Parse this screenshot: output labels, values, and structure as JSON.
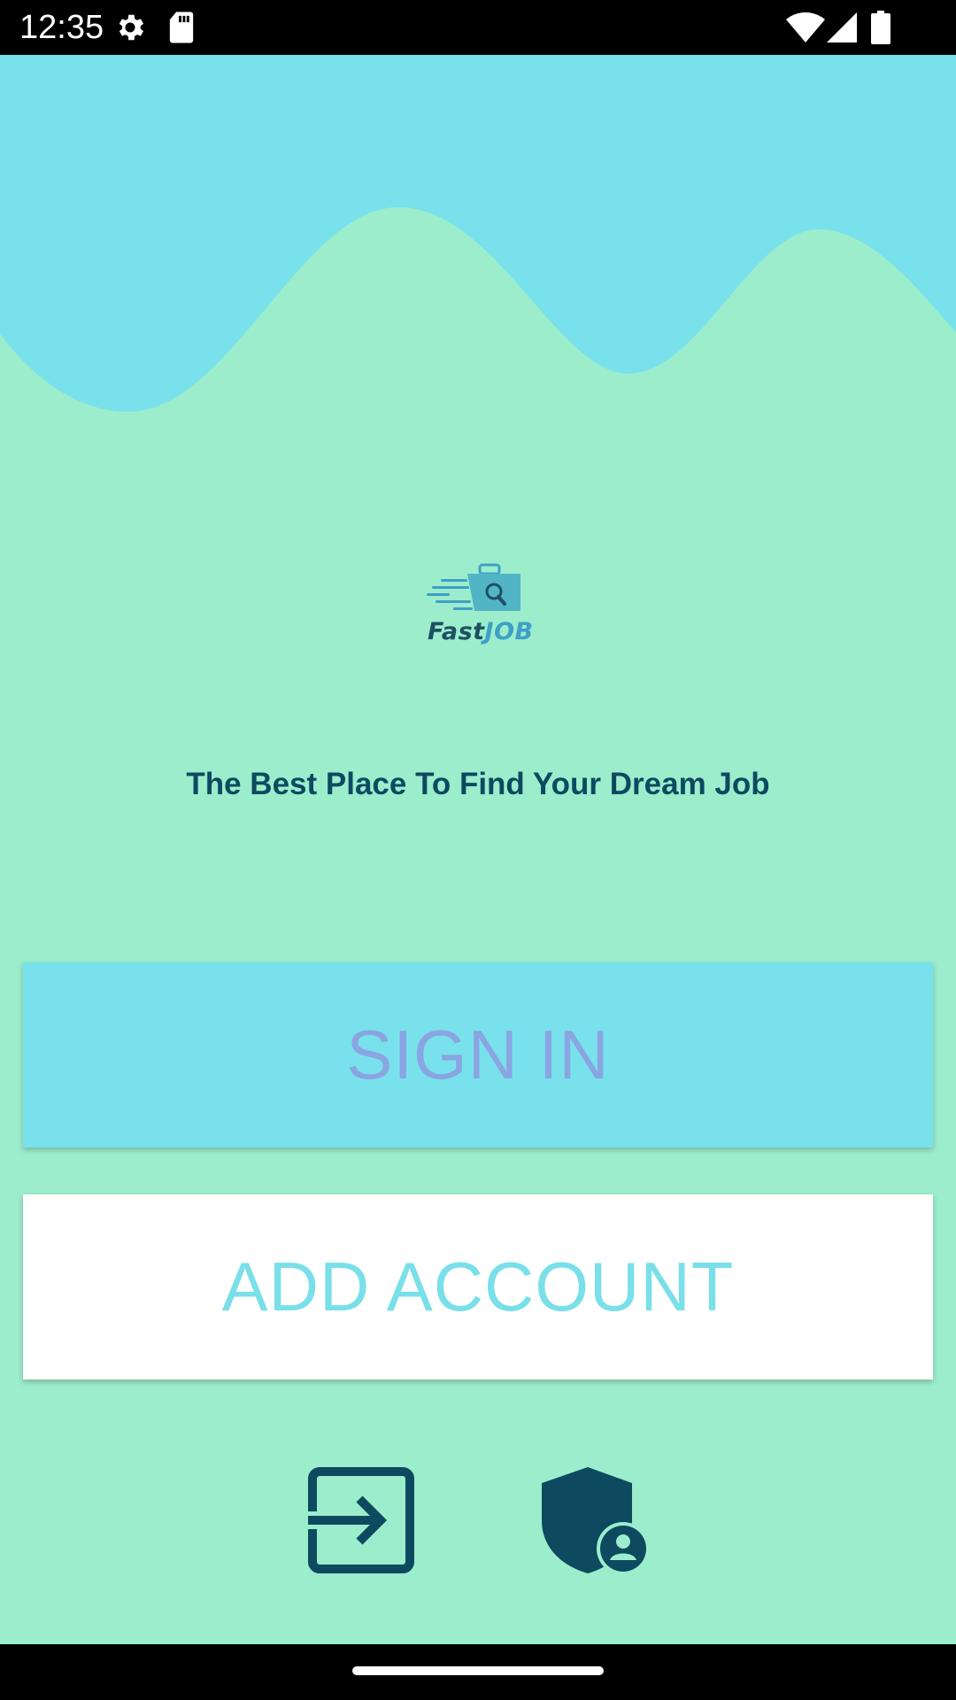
{
  "status_bar": {
    "time": "12:35",
    "icons": [
      "gear-icon",
      "sd-card-icon",
      "wifi-icon",
      "signal-icon",
      "battery-icon"
    ]
  },
  "logo": {
    "brand_fast": "Fast",
    "brand_job": "JOB"
  },
  "tagline": "The Best Place To Find Your Dream Job",
  "buttons": {
    "sign_in": "SIGN IN",
    "add_account": "ADD ACCOUNT"
  },
  "bottom_icons": [
    "exit-to-app-icon",
    "admin-shield-icon"
  ],
  "colors": {
    "background": "#9bedcc",
    "wave": "#79e1eb",
    "sign_in_button": "#79e1eb",
    "sign_in_text": "#8aa5e2",
    "add_account_button": "#ffffff",
    "add_account_text": "#79dfe9",
    "dark_teal": "#0d4a60"
  }
}
